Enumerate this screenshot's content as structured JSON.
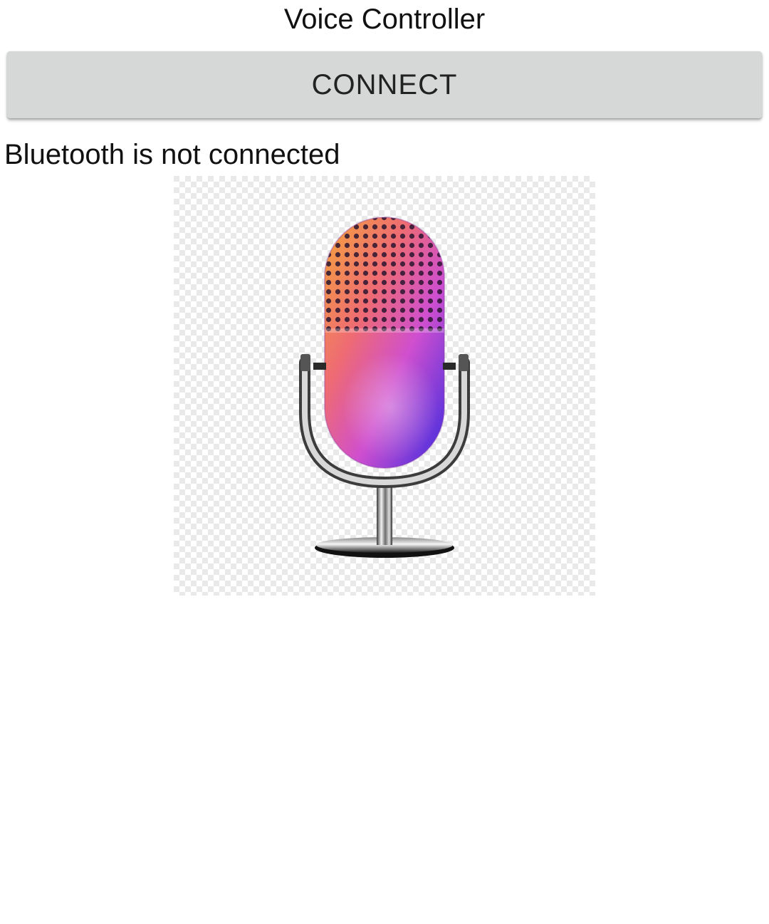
{
  "app": {
    "title": "Voice Controller"
  },
  "connect_button": {
    "label": "CONNECT"
  },
  "status": {
    "text": "Bluetooth is not connected"
  },
  "mic_image": {
    "icon": "microphone-icon"
  },
  "colors": {
    "button_background": "#d6d7d7",
    "text": "#111111",
    "background": "#ffffff"
  }
}
